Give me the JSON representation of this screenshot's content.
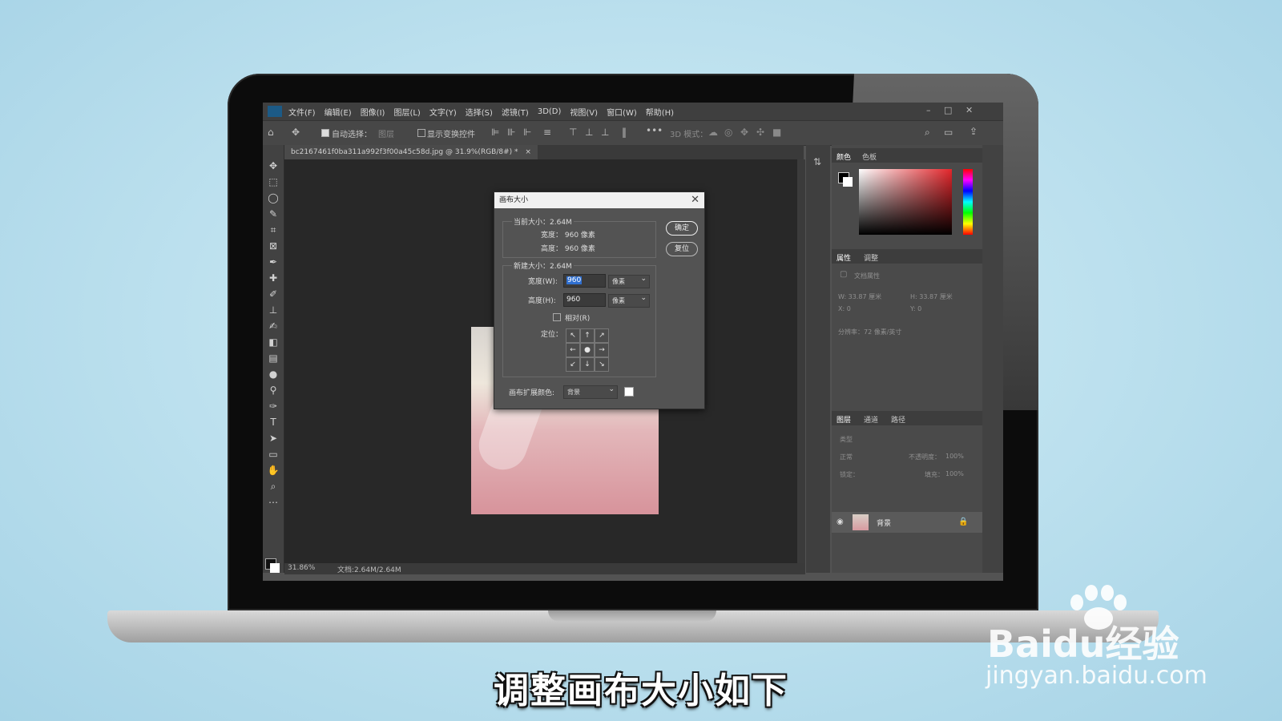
{
  "menubar": {
    "items": [
      "文件(F)",
      "编辑(E)",
      "图像(I)",
      "图层(L)",
      "文字(Y)",
      "选择(S)",
      "滤镜(T)",
      "3D(D)",
      "视图(V)",
      "窗口(W)",
      "帮助(H)"
    ]
  },
  "options": {
    "auto_select_label": "自动选择：",
    "auto_select_value": "图层",
    "show_transform_label": "显示变换控件",
    "mode_3d_label": "3D 模式："
  },
  "document": {
    "tab_title": "bc2167461f0ba311a992f3f00a45c58d.jpg @ 31.9%(RGB/8#) *"
  },
  "status": {
    "zoom": "31.86%",
    "doc": "文档:2.64M/2.64M"
  },
  "panels": {
    "color_tab": "颜色",
    "swatches_tab": "色板",
    "properties_tab": "属性",
    "adjust_tab": "调整",
    "doc_props": "文档属性",
    "w": "W:  33.87 厘米",
    "h": "H:  33.87 厘米",
    "x": "X:  0",
    "y": "Y:  0",
    "resolution": "分辨率：72 像素/英寸",
    "layers_tab": "图层",
    "channels_tab": "通道",
    "paths_tab": "路径",
    "kind_filter": "类型",
    "blend_mode": "正常",
    "opacity_label": "不透明度：",
    "opacity_value": "100%",
    "lock_label": "锁定：",
    "fill_label": "填充：",
    "fill_value": "100%",
    "layer_name": "背景"
  },
  "dialog": {
    "title": "画布大小",
    "current_size_label": "当前大小：2.64M",
    "cur_width": "宽度：  960 像素",
    "cur_height": "高度：  960 像素",
    "ok_label": "确定",
    "reset_label": "复位",
    "new_size_label": "新建大小：2.64M",
    "width_label": "宽度(W):",
    "width_value": "960",
    "height_label": "高度(H):",
    "height_value": "960",
    "unit": "像素",
    "relative_label": "相对(R)",
    "anchor_label": "定位：",
    "ext_color_label": "画布扩展颜色:",
    "ext_color_value": "背景"
  },
  "subtitle": "调整画布大小如下",
  "watermark": {
    "logo": "Baidu经验",
    "url": "jingyan.baidu.com"
  },
  "colors": {
    "ui_dark": "#535353",
    "canvas_bg": "#282828",
    "selection_blue": "#2f6fd0",
    "accent_red": "#e3262b"
  }
}
